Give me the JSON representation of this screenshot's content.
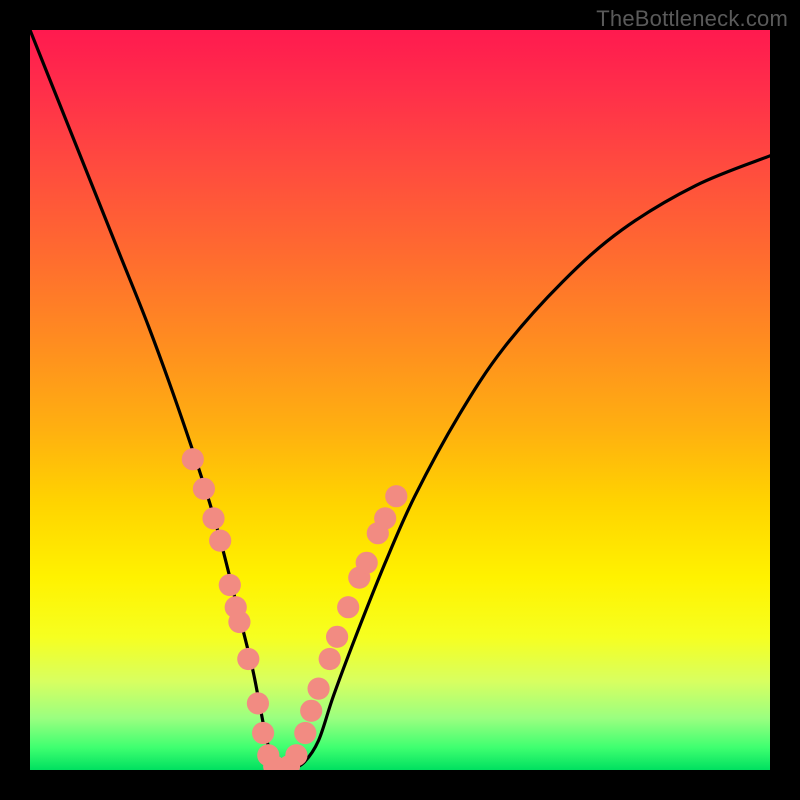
{
  "watermark": "TheBottleneck.com",
  "chart_data": {
    "type": "line",
    "title": "",
    "xlabel": "",
    "ylabel": "",
    "xlim": [
      0,
      100
    ],
    "ylim": [
      0,
      100
    ],
    "series": [
      {
        "name": "bottleneck-curve",
        "x": [
          0,
          4,
          8,
          12,
          16,
          20,
          24,
          26,
          28,
          30,
          31,
          32,
          33,
          34,
          35,
          37,
          39,
          41,
          44,
          48,
          52,
          58,
          64,
          72,
          80,
          90,
          100
        ],
        "values": [
          100,
          90,
          80,
          70,
          60,
          49,
          37,
          30,
          22,
          14,
          9,
          4,
          1,
          0,
          0,
          1,
          4,
          10,
          18,
          28,
          37,
          48,
          57,
          66,
          73,
          79,
          83
        ]
      }
    ],
    "markers": {
      "name": "highlight-dots",
      "color": "#f28b82",
      "radius_pct": 1.5,
      "points": [
        {
          "x": 22.0,
          "value": 42
        },
        {
          "x": 23.5,
          "value": 38
        },
        {
          "x": 24.8,
          "value": 34
        },
        {
          "x": 25.7,
          "value": 31
        },
        {
          "x": 27.0,
          "value": 25
        },
        {
          "x": 27.8,
          "value": 22
        },
        {
          "x": 28.3,
          "value": 20
        },
        {
          "x": 29.5,
          "value": 15
        },
        {
          "x": 30.8,
          "value": 9
        },
        {
          "x": 31.5,
          "value": 5
        },
        {
          "x": 32.2,
          "value": 2
        },
        {
          "x": 33.0,
          "value": 0.5
        },
        {
          "x": 34.0,
          "value": 0
        },
        {
          "x": 35.0,
          "value": 0.5
        },
        {
          "x": 36.0,
          "value": 2
        },
        {
          "x": 37.2,
          "value": 5
        },
        {
          "x": 38.0,
          "value": 8
        },
        {
          "x": 39.0,
          "value": 11
        },
        {
          "x": 40.5,
          "value": 15
        },
        {
          "x": 41.5,
          "value": 18
        },
        {
          "x": 43.0,
          "value": 22
        },
        {
          "x": 44.5,
          "value": 26
        },
        {
          "x": 45.5,
          "value": 28
        },
        {
          "x": 47.0,
          "value": 32
        },
        {
          "x": 48.0,
          "value": 34
        },
        {
          "x": 49.5,
          "value": 37
        }
      ]
    }
  }
}
